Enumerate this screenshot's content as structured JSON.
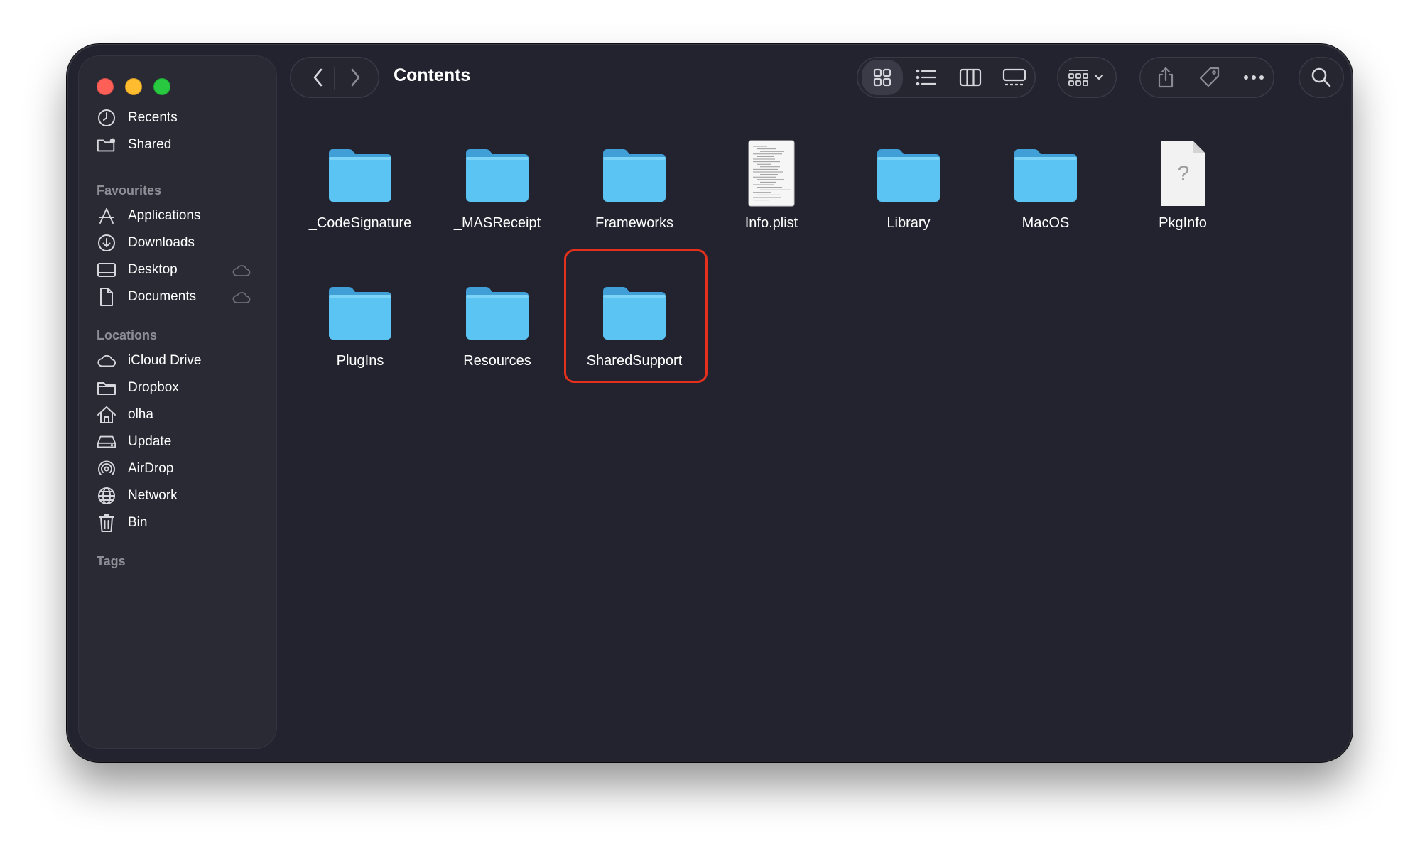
{
  "window": {
    "title": "Contents"
  },
  "sidebar": {
    "top_items": [
      {
        "label": "Recents",
        "icon": "clock-icon"
      },
      {
        "label": "Shared",
        "icon": "shared-folder-icon"
      }
    ],
    "sections": [
      {
        "header": "Favourites",
        "items": [
          {
            "label": "Applications",
            "icon": "applications-icon"
          },
          {
            "label": "Downloads",
            "icon": "download-icon"
          },
          {
            "label": "Desktop",
            "icon": "desktop-icon",
            "cloud": true
          },
          {
            "label": "Documents",
            "icon": "document-icon",
            "cloud": true
          }
        ]
      },
      {
        "header": "Locations",
        "items": [
          {
            "label": "iCloud Drive",
            "icon": "cloud-icon"
          },
          {
            "label": "Dropbox",
            "icon": "folder-icon"
          },
          {
            "label": "olha",
            "icon": "home-icon"
          },
          {
            "label": "Update",
            "icon": "drive-icon"
          },
          {
            "label": "AirDrop",
            "icon": "airdrop-icon"
          },
          {
            "label": "Network",
            "icon": "globe-icon"
          },
          {
            "label": "Bin",
            "icon": "trash-icon"
          }
        ]
      },
      {
        "header": "Tags",
        "items": []
      }
    ]
  },
  "toolbar": {
    "back_icon": "chevron-left-icon",
    "forward_icon": "chevron-right-icon",
    "views": [
      "icon-view-icon",
      "list-view-icon",
      "column-view-icon",
      "gallery-view-icon"
    ],
    "active_view": "icon-view-icon",
    "group_icon": "group-by-icon",
    "actions": [
      "share-icon",
      "tag-icon",
      "more-icon"
    ],
    "search_icon": "search-icon"
  },
  "items": [
    {
      "name": "_CodeSignature",
      "kind": "folder"
    },
    {
      "name": "_MASReceipt",
      "kind": "folder"
    },
    {
      "name": "Frameworks",
      "kind": "folder"
    },
    {
      "name": "Info.plist",
      "kind": "plist-document"
    },
    {
      "name": "Library",
      "kind": "folder"
    },
    {
      "name": "MacOS",
      "kind": "folder"
    },
    {
      "name": "PkgInfo",
      "kind": "unknown-document"
    },
    {
      "name": "PlugIns",
      "kind": "folder"
    },
    {
      "name": "Resources",
      "kind": "folder"
    },
    {
      "name": "SharedSupport",
      "kind": "folder",
      "highlighted": true
    }
  ],
  "colors": {
    "window_bg": "#23232f",
    "sidebar_bg": "#2a2a35",
    "folder_blue": "#5bc4f2",
    "highlight_red": "#e4301c"
  }
}
